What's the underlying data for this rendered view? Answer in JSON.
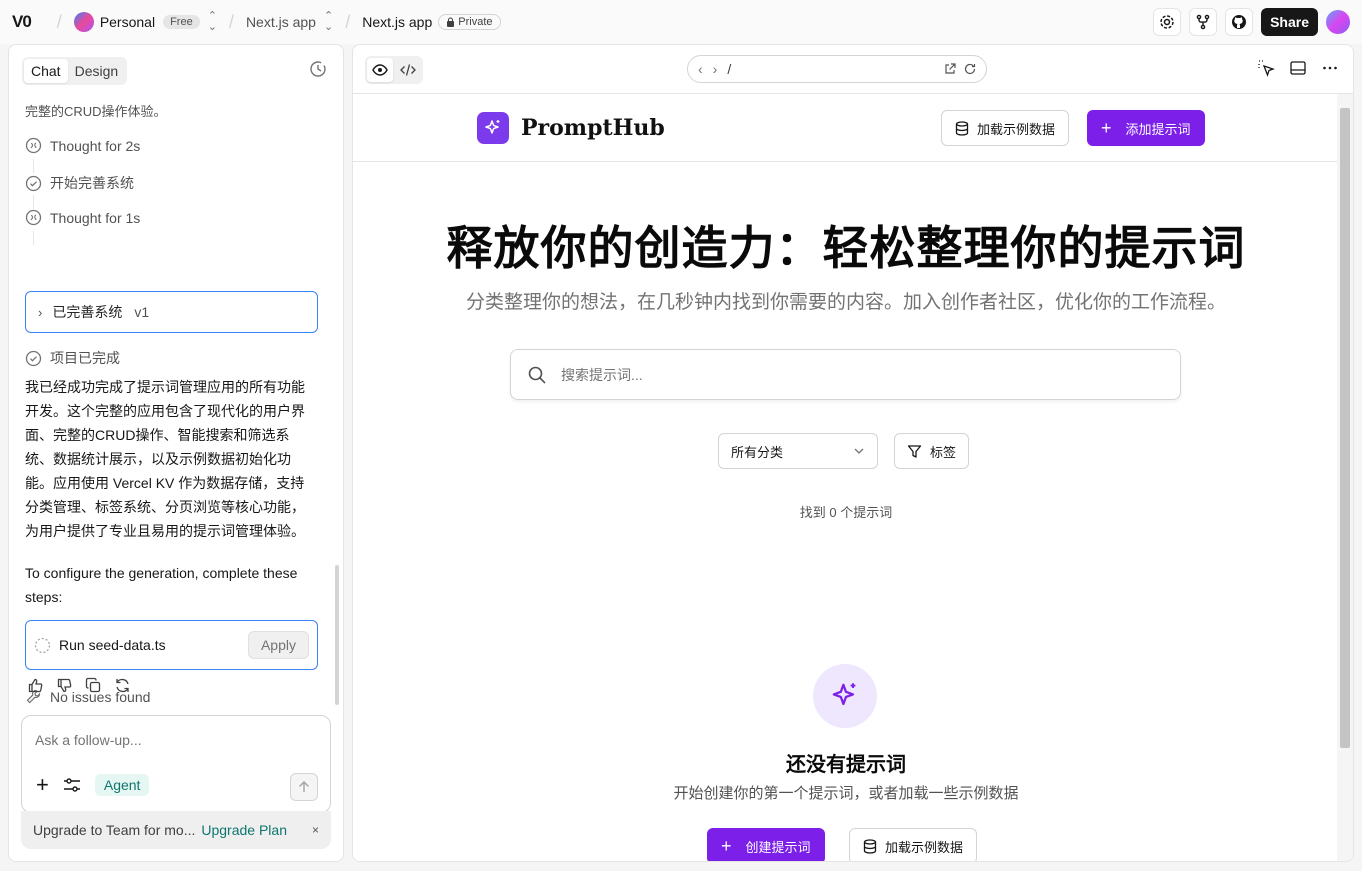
{
  "topbar": {
    "logo": "V0",
    "workspace": "Personal",
    "plan_badge": "Free",
    "project": "Next.js app",
    "chat_title": "Next.js app",
    "visibility": "Private",
    "share_label": "Share"
  },
  "left": {
    "tabs": [
      "Chat",
      "Design"
    ],
    "active_tab": "Chat",
    "prev_text": "完整的CRUD操作体验。",
    "steps": [
      {
        "label": "Thought for 2s"
      },
      {
        "label": "开始完善系统"
      },
      {
        "label": "Thought for 1s"
      }
    ],
    "version_block": {
      "label": "已完善系统",
      "version": "v1"
    },
    "done_label": "项目已完成",
    "summary": "我已经成功完成了提示词管理应用的所有功能开发。这个完整的应用包含了现代化的用户界面、完整的CRUD操作、智能搜索和筛选系统、数据统计展示，以及示例数据初始化功能。应用使用 Vercel KV 作为数据存储，支持分类管理、标签系统、分页浏览等核心功能，为用户提供了专业且易用的提示词管理体验。",
    "configure_text": "To configure the generation, complete these steps:",
    "task": {
      "label": "Run seed-data.ts",
      "button": "Apply"
    },
    "issues_label": "No issues found",
    "composer": {
      "placeholder": "Ask a follow-up...",
      "agent_label": "Agent"
    },
    "upgrade": {
      "text": "Upgrade to Team for mo...",
      "link": "Upgrade Plan",
      "close": "×"
    }
  },
  "preview": {
    "url": "/",
    "app": {
      "brand": "PromptHub",
      "load_sample_label": "加载示例数据",
      "add_prompt_label": "添加提示词",
      "hero_title": "释放你的创造力：轻松整理你的提示词",
      "hero_subtitle": "分类整理你的想法，在几秒钟内找到你需要的内容。加入创作者社区，优化你的工作流程。",
      "search_placeholder": "搜索提示词...",
      "category_select": "所有分类",
      "tag_filter_label": "标签",
      "found_text": "找到 0 个提示词",
      "empty_title": "还没有提示词",
      "empty_subtitle": "开始创建你的第一个提示词，或者加载一些示例数据",
      "create_label": "创建提示词",
      "load_sample_label_2": "加载示例数据"
    }
  },
  "colors": {
    "accent": "#7c1fe8",
    "focus_border": "#3b82f6",
    "agent_text": "#0f766e"
  }
}
